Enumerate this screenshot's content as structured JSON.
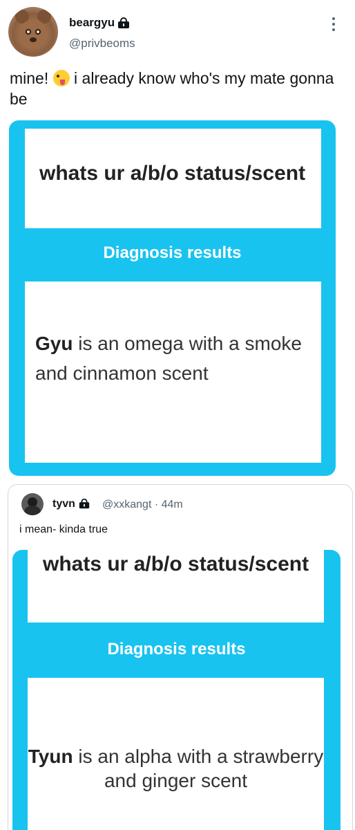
{
  "tweet": {
    "display_name": "beargyu",
    "handle": "@privbeoms",
    "text_before_emoji": "mine! ",
    "text_after_emoji": " i already know who's my mate gonna be",
    "emoji": "winking-face-with-tongue"
  },
  "card1": {
    "question": "whats ur a/b/o status/scent",
    "header": "Diagnosis results",
    "result_name": "Gyu",
    "result_text": " is an omega with a smoke and cinnamon scent"
  },
  "quote": {
    "display_name": "tyvn",
    "handle": "@xxkangt",
    "time": " · 44m",
    "text": "i mean- kinda true",
    "card": {
      "question": "whats ur a/b/o status/scent",
      "header": "Diagnosis results",
      "result_name": "Tyun",
      "result_text": "  is an alpha with a strawberry and ginger scent"
    }
  },
  "colors": {
    "card_blue": "#19c3f0",
    "secondary_text": "#536471"
  },
  "icons": [
    "lock-icon",
    "more-options-icon"
  ]
}
